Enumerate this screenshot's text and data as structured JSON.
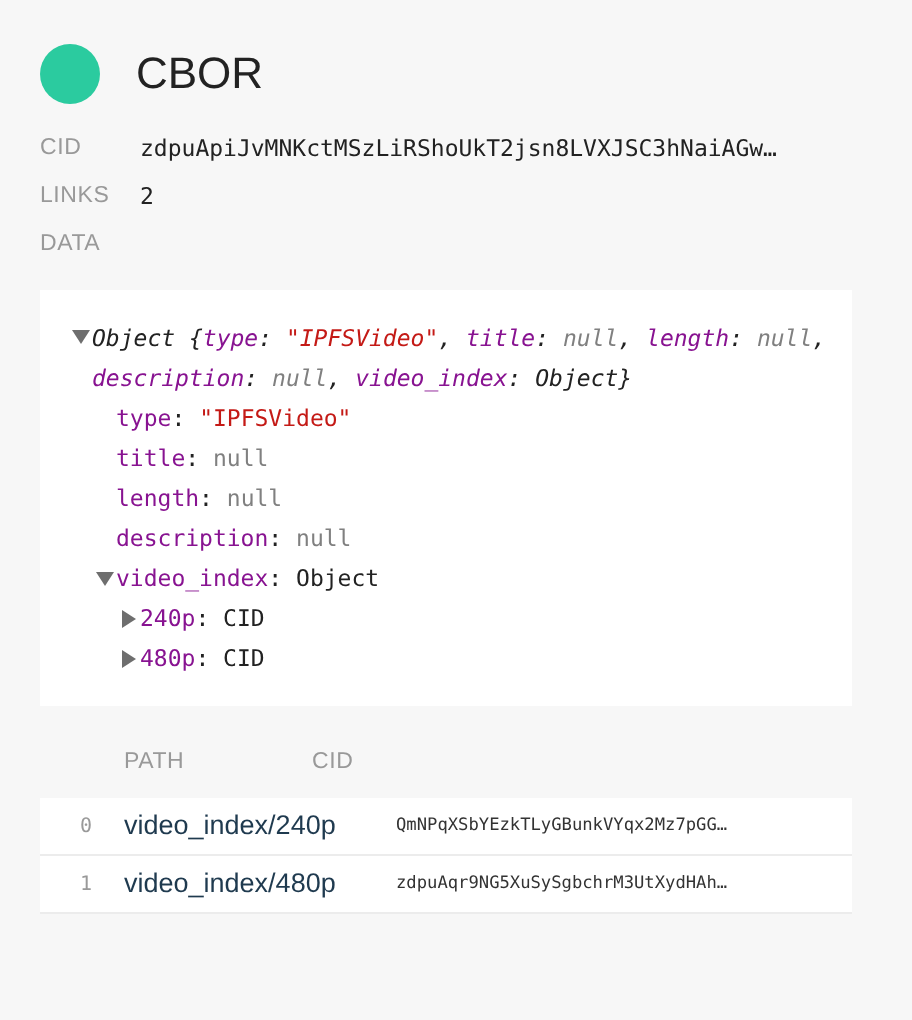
{
  "header": {
    "title": "CBOR",
    "color": "#2bcb9f"
  },
  "fields": [
    {
      "label": "CID",
      "value": "zdpuApiJvMNKctMSzLiRShoUkT2jsn8LVXJSC3hNaiAGw…"
    },
    {
      "label": "LINKS",
      "value": "2"
    },
    {
      "label": "DATA"
    }
  ],
  "tree": {
    "expanded": true,
    "summary": [
      {
        "text": "Object {",
        "kind": "plain"
      },
      {
        "text": "type",
        "kind": "key"
      },
      {
        "text": ": ",
        "kind": "plain"
      },
      {
        "text": "\"IPFSVideo\"",
        "kind": "string"
      },
      {
        "text": ", ",
        "kind": "plain"
      },
      {
        "text": "title",
        "kind": "key"
      },
      {
        "text": ": ",
        "kind": "plain"
      },
      {
        "text": "null",
        "kind": "null"
      },
      {
        "text": ", ",
        "kind": "plain"
      },
      {
        "text": "length",
        "kind": "key"
      },
      {
        "text": ": ",
        "kind": "plain"
      },
      {
        "text": "null",
        "kind": "null"
      },
      {
        "text": ", ",
        "kind": "plain"
      },
      {
        "text": "description",
        "kind": "key"
      },
      {
        "text": ": ",
        "kind": "plain"
      },
      {
        "text": "null",
        "kind": "null"
      },
      {
        "text": ", ",
        "kind": "plain"
      },
      {
        "text": "video_index",
        "kind": "key"
      },
      {
        "text": ": ",
        "kind": "plain"
      },
      {
        "text": "Object}",
        "kind": "plain"
      }
    ],
    "children": [
      {
        "parts": [
          {
            "text": "type",
            "kind": "key"
          },
          {
            "text": ": ",
            "kind": "plain"
          },
          {
            "text": "\"IPFSVideo\"",
            "kind": "string"
          }
        ]
      },
      {
        "parts": [
          {
            "text": "title",
            "kind": "key"
          },
          {
            "text": ": ",
            "kind": "plain"
          },
          {
            "text": "null",
            "kind": "null"
          }
        ]
      },
      {
        "parts": [
          {
            "text": "length",
            "kind": "key"
          },
          {
            "text": ": ",
            "kind": "plain"
          },
          {
            "text": "null",
            "kind": "null"
          }
        ]
      },
      {
        "parts": [
          {
            "text": "description",
            "kind": "key"
          },
          {
            "text": ": ",
            "kind": "plain"
          },
          {
            "text": "null",
            "kind": "null"
          }
        ]
      },
      {
        "parts": [
          {
            "text": "video_index",
            "kind": "key"
          },
          {
            "text": ": Object",
            "kind": "plain"
          }
        ],
        "expanded": true,
        "children": [
          {
            "parts": [
              {
                "text": "240p",
                "kind": "key"
              },
              {
                "text": ": CID",
                "kind": "plain"
              }
            ],
            "expanded": false
          },
          {
            "parts": [
              {
                "text": "480p",
                "kind": "key"
              },
              {
                "text": ": CID",
                "kind": "plain"
              }
            ],
            "expanded": false
          }
        ]
      }
    ]
  },
  "links_table": {
    "columns": [
      "PATH",
      "CID"
    ],
    "rows": [
      {
        "index": "0",
        "path": "video_index/240p",
        "cid": "QmNPqXSbYEzkTLyGBunkVYqx2Mz7pGG…"
      },
      {
        "index": "1",
        "path": "video_index/480p",
        "cid": "zdpuAqr9NG5XuSySgbchrM3UtXydHAh…"
      }
    ]
  }
}
